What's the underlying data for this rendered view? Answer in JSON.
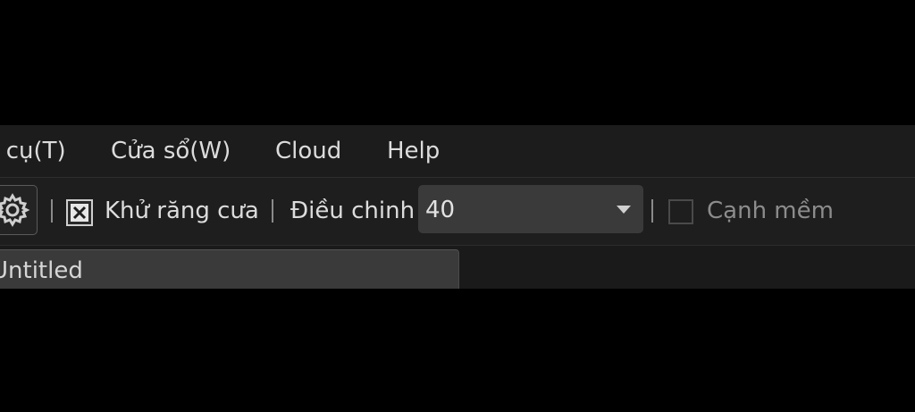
{
  "menu": {
    "items": [
      {
        "label": "ụ cụ(T)"
      },
      {
        "label": "Cửa sổ(W)"
      },
      {
        "label": "Cloud"
      },
      {
        "label": "Help"
      }
    ]
  },
  "toolbar": {
    "settings_icon": "gear-icon",
    "antialias_label": "Khử răng cưa",
    "antialias_checked": true,
    "adjust_label": "Điều chinh",
    "adjust_value": "40",
    "softedge_label": "Cạnh mềm",
    "softedge_checked": false
  },
  "tabs": {
    "document_tab_label": "Untitled"
  },
  "colors": {
    "background": "#000000",
    "menubar": "#1c1c1c",
    "toolbar": "#1e1e1e",
    "dropdown": "#3a3a3a",
    "tab": "#3a3a3a",
    "text": "#dcdcdc"
  }
}
